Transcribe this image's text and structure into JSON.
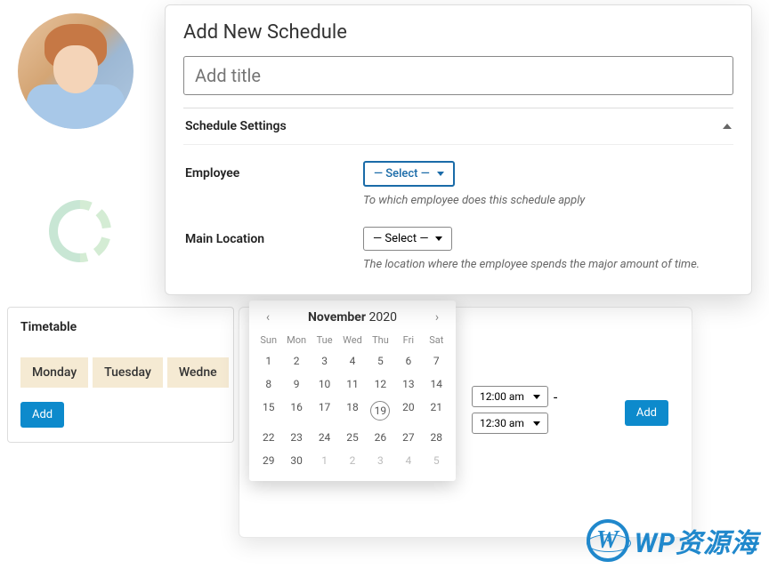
{
  "schedule": {
    "heading": "Add New Schedule",
    "title_placeholder": "Add title",
    "settings_label": "Schedule Settings",
    "employee": {
      "label": "Employee",
      "select": "— Select —",
      "help": "To which employee does this schedule apply"
    },
    "location": {
      "label": "Main Location",
      "select": "— Select —",
      "help": "The location where the employee spends the major amount of time."
    }
  },
  "timetable": {
    "heading": "Timetable",
    "days": [
      "Monday",
      "Tuesday",
      "Wedne"
    ],
    "add": "Add"
  },
  "calendar": {
    "month": "November",
    "year": "2020",
    "dow": [
      "Sun",
      "Mon",
      "Tue",
      "Wed",
      "Thu",
      "Fri",
      "Sat"
    ],
    "weeks": [
      [
        {
          "d": 1
        },
        {
          "d": 2
        },
        {
          "d": 3
        },
        {
          "d": 4
        },
        {
          "d": 5
        },
        {
          "d": 6
        },
        {
          "d": 7
        }
      ],
      [
        {
          "d": 8
        },
        {
          "d": 9
        },
        {
          "d": 10
        },
        {
          "d": 11
        },
        {
          "d": 12
        },
        {
          "d": 13
        },
        {
          "d": 14
        }
      ],
      [
        {
          "d": 15
        },
        {
          "d": 16
        },
        {
          "d": 17
        },
        {
          "d": 18
        },
        {
          "d": 19,
          "today": true
        },
        {
          "d": 20
        },
        {
          "d": 21
        }
      ],
      [
        {
          "d": 22
        },
        {
          "d": 23
        },
        {
          "d": 24
        },
        {
          "d": 25
        },
        {
          "d": 26
        },
        {
          "d": 27
        },
        {
          "d": 28
        }
      ],
      [
        {
          "d": 29
        },
        {
          "d": 30
        },
        {
          "d": 1,
          "muted": true
        },
        {
          "d": 2,
          "muted": true
        },
        {
          "d": 3,
          "muted": true
        },
        {
          "d": 4,
          "muted": true
        },
        {
          "d": 5,
          "muted": true
        }
      ]
    ]
  },
  "time": {
    "start": "12:00 am",
    "end": "12:30 am",
    "sep": "-"
  },
  "bottom": {
    "add": "Add"
  },
  "watermark": {
    "text": "WP资源海",
    "logo": "W"
  }
}
